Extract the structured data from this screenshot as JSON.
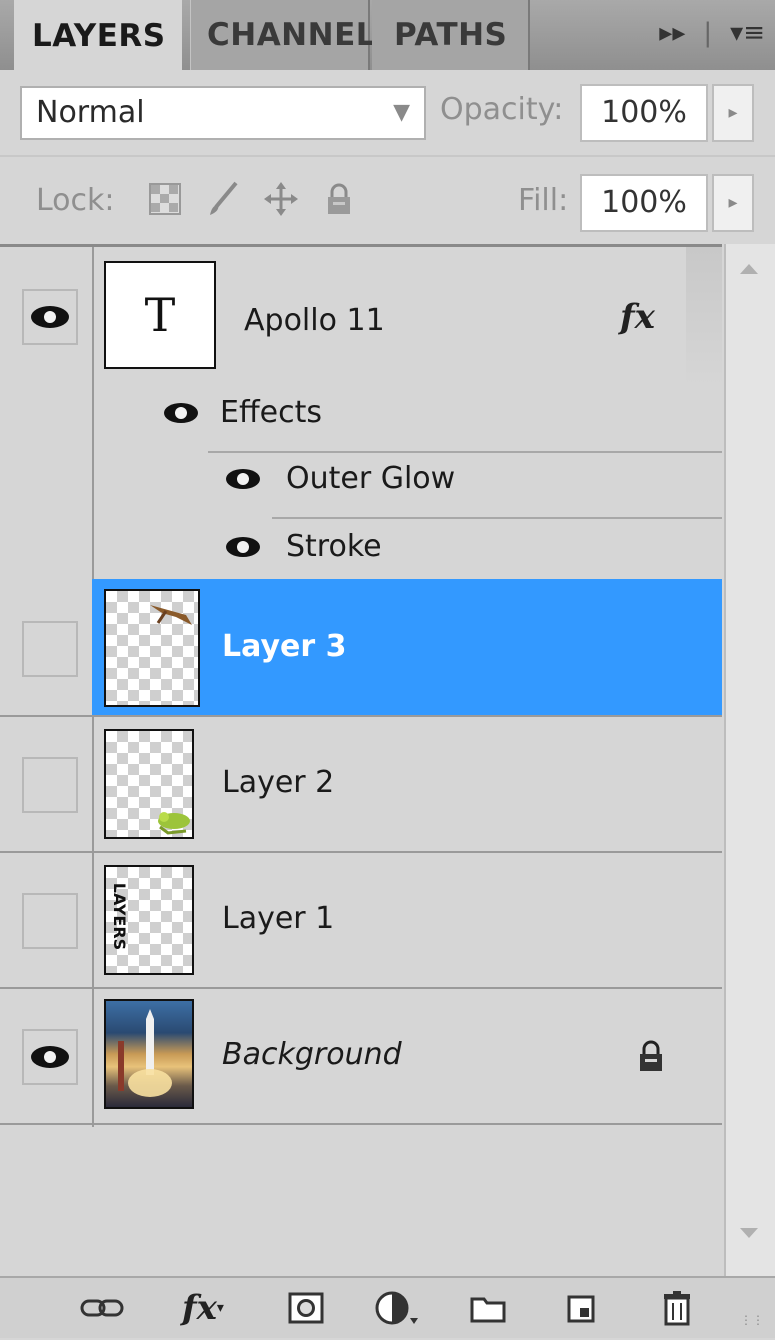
{
  "tabs": {
    "layers": "LAYERS",
    "channels": "CHANNEL",
    "paths": "PATHS",
    "expand_icon": "double-arrow-icon",
    "menu_icon": "panel-menu-icon"
  },
  "blend": {
    "mode": "Normal",
    "opacity_label": "Opacity:",
    "opacity_value": "100%"
  },
  "lock": {
    "label": "Lock:",
    "icons": [
      "lock-transparent-icon",
      "lock-paint-icon",
      "lock-position-icon",
      "lock-all-icon"
    ],
    "fill_label": "Fill:",
    "fill_value": "100%"
  },
  "layers": [
    {
      "name": "Apollo 11",
      "visible": true,
      "type": "text",
      "thumb_letter": "T",
      "fx": "fx",
      "effects_label": "Effects",
      "effects": [
        "Outer Glow",
        "Stroke"
      ]
    },
    {
      "name": "Layer 3",
      "visible": false,
      "selected": true
    },
    {
      "name": "Layer 2",
      "visible": false
    },
    {
      "name": "Layer 1",
      "visible": false,
      "thumb_text": "LAYERS"
    },
    {
      "name": "Background",
      "visible": true,
      "locked": true
    }
  ],
  "bottom_icons": [
    "link-icon",
    "fx-icon",
    "mask-icon",
    "adjustment-icon",
    "group-folder-icon",
    "new-layer-icon",
    "trash-icon"
  ],
  "colors": {
    "selection": "#3399ff",
    "panel": "#d6d6d6"
  }
}
